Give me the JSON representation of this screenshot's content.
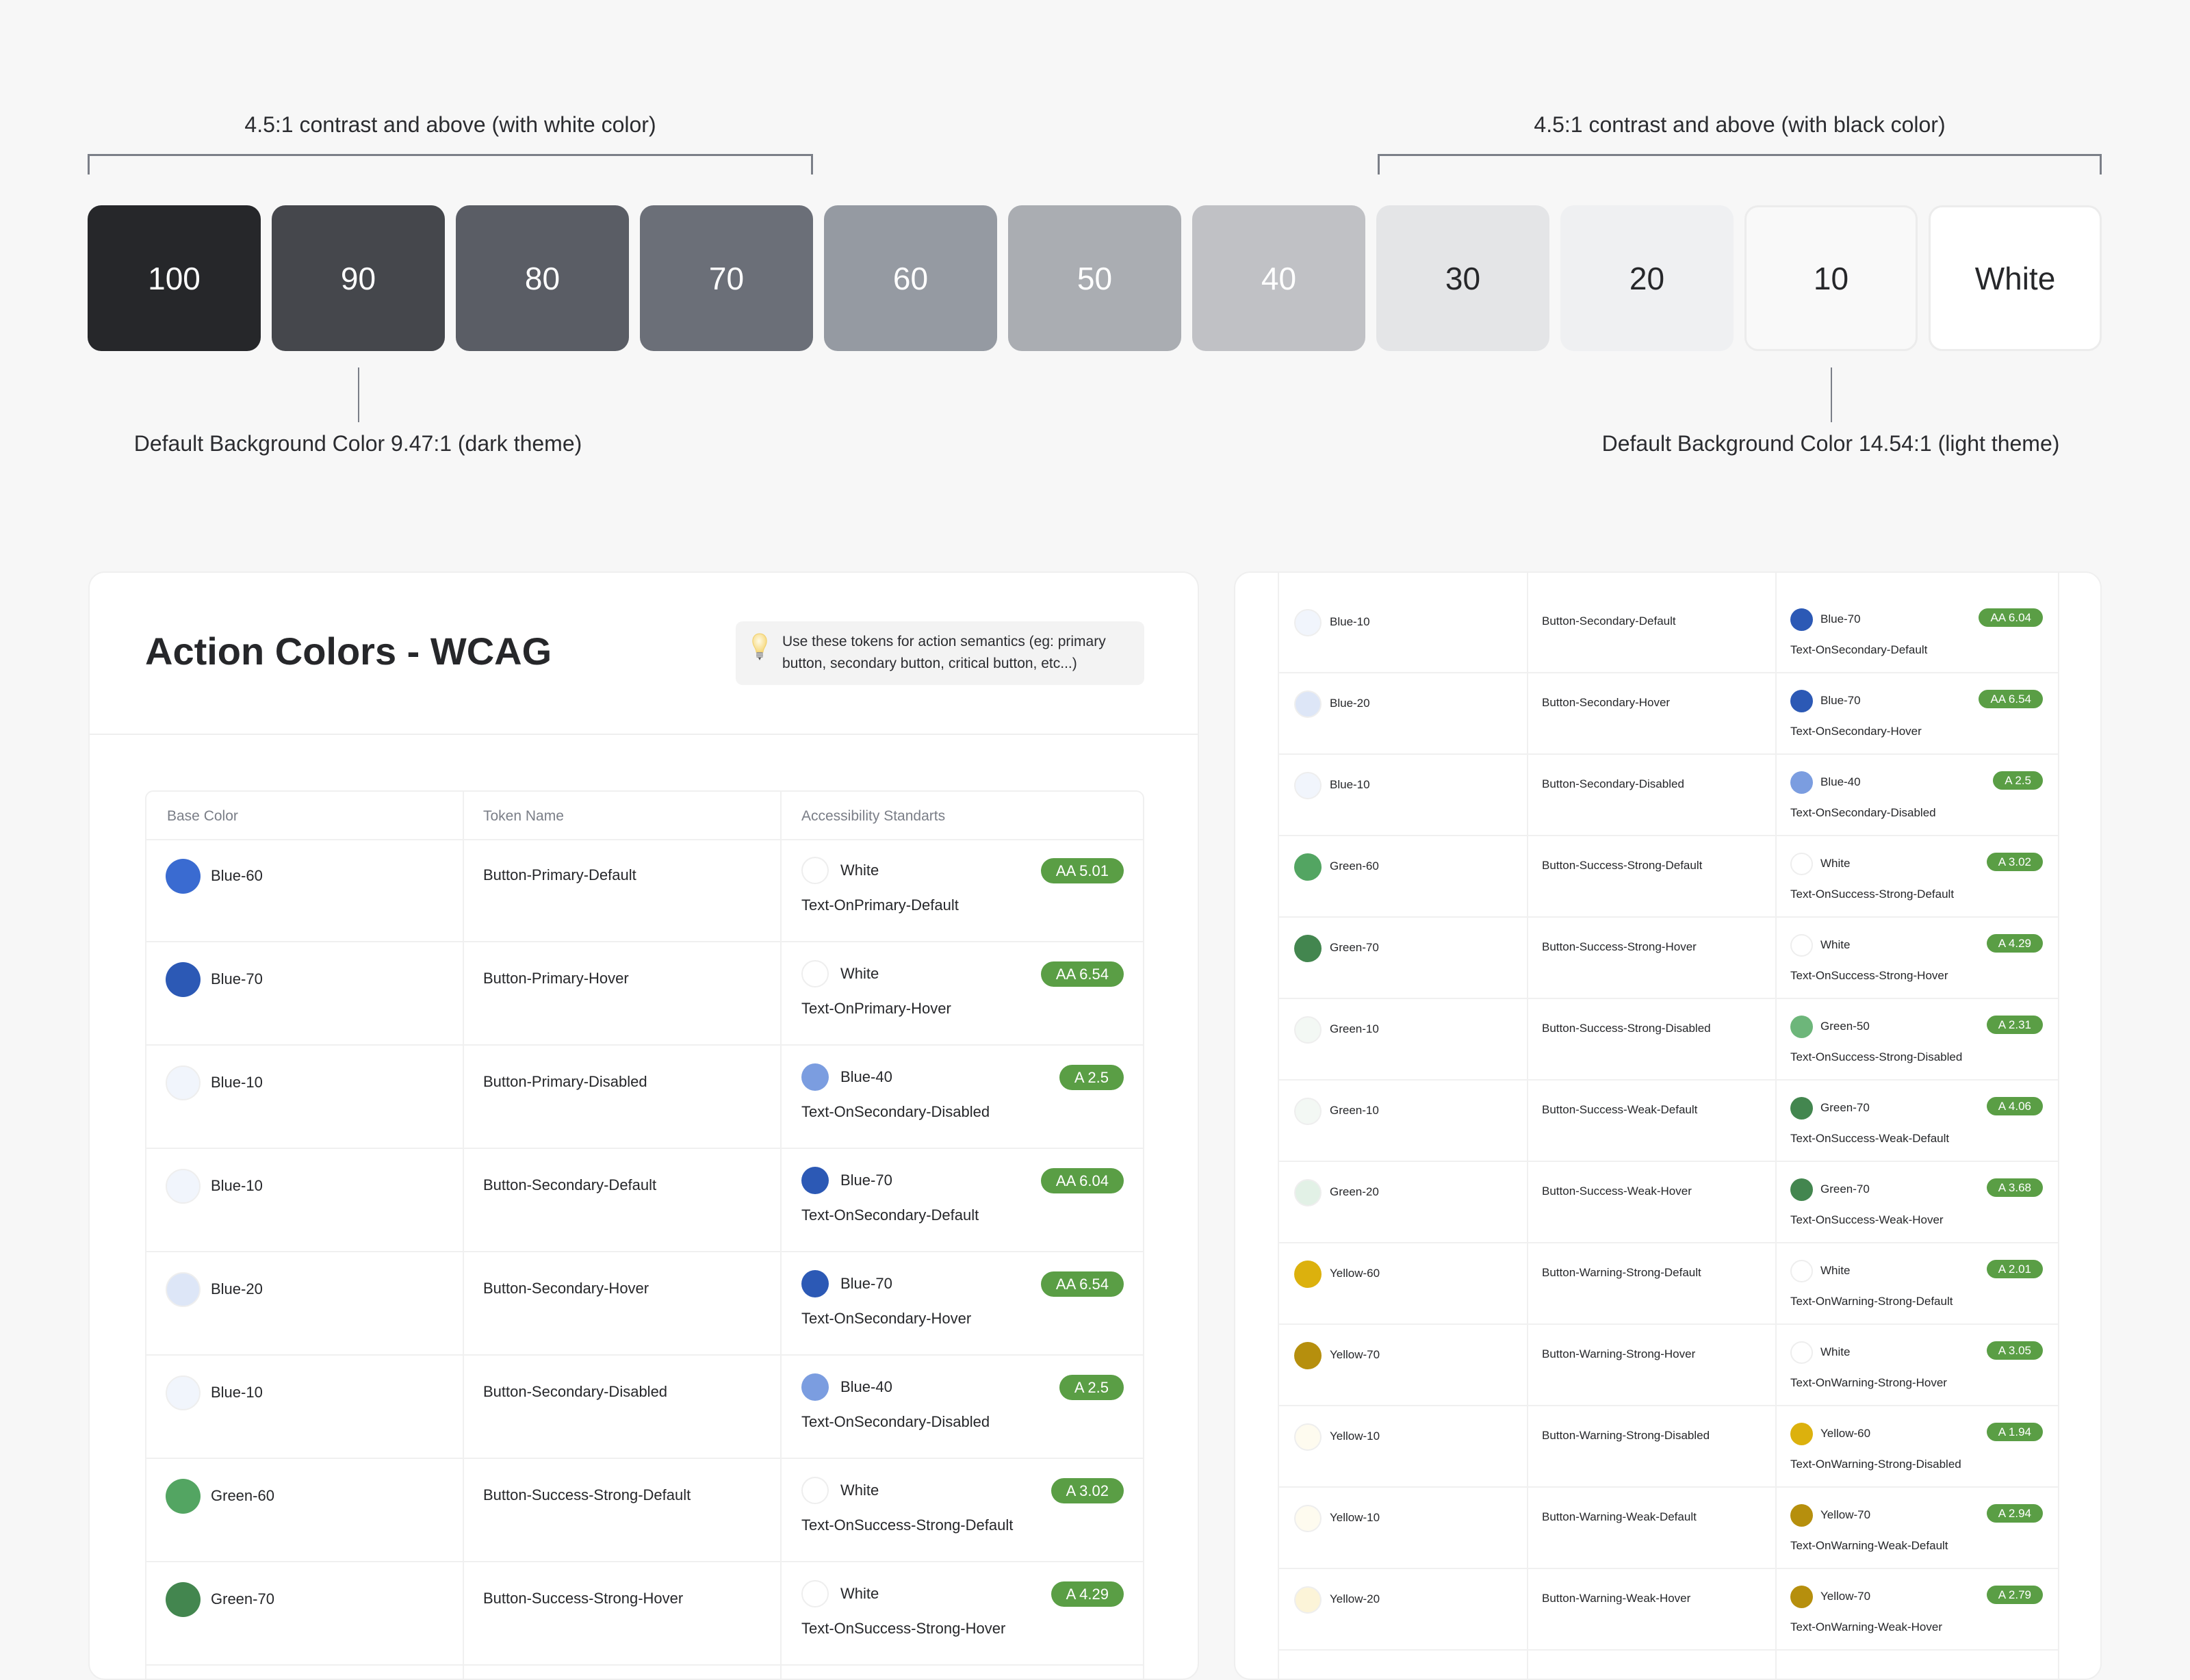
{
  "scale": {
    "white_range_label": "4.5:1 contrast and above (with white color)",
    "black_range_label": "4.5:1 contrast and above (with black color)",
    "swatches": [
      {
        "label": "100",
        "color": "#26272a",
        "text_color": "#ffffff"
      },
      {
        "label": "90",
        "color": "#45474c",
        "text_color": "#ffffff"
      },
      {
        "label": "80",
        "color": "#5a5d65",
        "text_color": "#ffffff"
      },
      {
        "label": "70",
        "color": "#6b6f78",
        "text_color": "#ffffff"
      },
      {
        "label": "60",
        "color": "#959aa2",
        "text_color": "#ffffff"
      },
      {
        "label": "50",
        "color": "#aaadb2",
        "text_color": "#ffffff"
      },
      {
        "label": "40",
        "color": "#c0c1c5",
        "text_color": "#ffffff"
      },
      {
        "label": "30",
        "color": "#e4e5e7",
        "text_color": "#26272a"
      },
      {
        "label": "20",
        "color": "#eff0f2",
        "text_color": "#26272a"
      },
      {
        "label": "10",
        "color": "#f9f9f9",
        "text_color": "#26272a"
      },
      {
        "label": "White",
        "color": "#ffffff",
        "text_color": "#26272a"
      }
    ],
    "dark_theme_note": "Default Background Color 9.47:1 (dark theme)",
    "light_theme_note": "Default Background Color 14.54:1 (light theme)"
  },
  "palette": {
    "Blue-10": "#f1f5fc",
    "Blue-20": "#dde6f7",
    "Blue-40": "#7b9de0",
    "Blue-60": "#3a6bd1",
    "Blue-70": "#2c59b5",
    "Green-10": "#f3f8f4",
    "Green-20": "#e2f1e6",
    "Green-50": "#6db67a",
    "Green-60": "#53a562",
    "Green-70": "#43864f",
    "Yellow-10": "#fefbef",
    "Yellow-20": "#fcf4d8",
    "Yellow-60": "#dcb10d",
    "Yellow-70": "#b68f0d",
    "White": "#ffffff",
    "badge": "#5a9e45"
  },
  "left_panel": {
    "title": "Action Colors - WCAG",
    "tip_icon": "lightbulb-icon",
    "tip_text": "Use these tokens for action semantics (eg: primary button, secondary button, critical button, etc...)",
    "columns": [
      "Base Color",
      "Token Name",
      "Accessibility Standarts"
    ],
    "rows": [
      {
        "base": "Blue-60",
        "token": "Button-Primary-Default",
        "on": "White",
        "badge": "AA 5.01",
        "text_token": "Text-OnPrimary-Default"
      },
      {
        "base": "Blue-70",
        "token": "Button-Primary-Hover",
        "on": "White",
        "badge": "AA 6.54",
        "text_token": "Text-OnPrimary-Hover"
      },
      {
        "base": "Blue-10",
        "token": "Button-Primary-Disabled",
        "on": "Blue-40",
        "badge": "A 2.5",
        "text_token": "Text-OnSecondary-Disabled"
      },
      {
        "base": "Blue-10",
        "token": "Button-Secondary-Default",
        "on": "Blue-70",
        "badge": "AA 6.04",
        "text_token": "Text-OnSecondary-Default"
      },
      {
        "base": "Blue-20",
        "token": "Button-Secondary-Hover",
        "on": "Blue-70",
        "badge": "AA 6.54",
        "text_token": "Text-OnSecondary-Hover"
      },
      {
        "base": "Blue-10",
        "token": "Button-Secondary-Disabled",
        "on": "Blue-40",
        "badge": "A 2.5",
        "text_token": "Text-OnSecondary-Disabled"
      },
      {
        "base": "Green-60",
        "token": "Button-Success-Strong-Default",
        "on": "White",
        "badge": "A 3.02",
        "text_token": "Text-OnSuccess-Strong-Default"
      },
      {
        "base": "Green-70",
        "token": "Button-Success-Strong-Hover",
        "on": "White",
        "badge": "A 4.29",
        "text_token": "Text-OnSuccess-Strong-Hover"
      }
    ]
  },
  "right_panel": {
    "rows": [
      {
        "base": "Blue-10",
        "token": "Button-Secondary-Default",
        "on": "Blue-70",
        "badge": "AA 6.04",
        "text_token": "Text-OnSecondary-Default"
      },
      {
        "base": "Blue-20",
        "token": "Button-Secondary-Hover",
        "on": "Blue-70",
        "badge": "AA 6.54",
        "text_token": "Text-OnSecondary-Hover"
      },
      {
        "base": "Blue-10",
        "token": "Button-Secondary-Disabled",
        "on": "Blue-40",
        "badge": "A 2.5",
        "text_token": "Text-OnSecondary-Disabled"
      },
      {
        "base": "Green-60",
        "token": "Button-Success-Strong-Default",
        "on": "White",
        "badge": "A 3.02",
        "text_token": "Text-OnSuccess-Strong-Default"
      },
      {
        "base": "Green-70",
        "token": "Button-Success-Strong-Hover",
        "on": "White",
        "badge": "A 4.29",
        "text_token": "Text-OnSuccess-Strong-Hover"
      },
      {
        "base": "Green-10",
        "token": "Button-Success-Strong-Disabled",
        "on": "Green-50",
        "badge": "A 2.31",
        "text_token": "Text-OnSuccess-Strong-Disabled"
      },
      {
        "base": "Green-10",
        "token": "Button-Success-Weak-Default",
        "on": "Green-70",
        "badge": "A 4.06",
        "text_token": "Text-OnSuccess-Weak-Default"
      },
      {
        "base": "Green-20",
        "token": "Button-Success-Weak-Hover",
        "on": "Green-70",
        "badge": "A 3.68",
        "text_token": "Text-OnSuccess-Weak-Hover"
      },
      {
        "base": "Yellow-60",
        "token": "Button-Warning-Strong-Default",
        "on": "White",
        "badge": "A 2.01",
        "text_token": "Text-OnWarning-Strong-Default"
      },
      {
        "base": "Yellow-70",
        "token": "Button-Warning-Strong-Hover",
        "on": "White",
        "badge": "A 3.05",
        "text_token": "Text-OnWarning-Strong-Hover"
      },
      {
        "base": "Yellow-10",
        "token": "Button-Warning-Strong-Disabled",
        "on": "Yellow-60",
        "badge": "A 1.94",
        "text_token": "Text-OnWarning-Strong-Disabled"
      },
      {
        "base": "Yellow-10",
        "token": "Button-Warning-Weak-Default",
        "on": "Yellow-70",
        "badge": "A 2.94",
        "text_token": "Text-OnWarning-Weak-Default"
      },
      {
        "base": "Yellow-20",
        "token": "Button-Warning-Weak-Hover",
        "on": "Yellow-70",
        "badge": "A 2.79",
        "text_token": "Text-OnWarning-Weak-Hover"
      }
    ]
  }
}
